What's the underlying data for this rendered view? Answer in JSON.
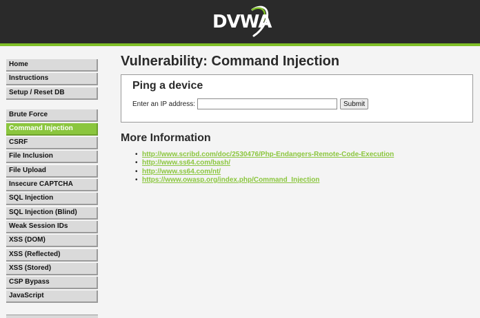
{
  "header": {
    "logo_text": "DVWA",
    "colors": {
      "background": "#2a2a2a",
      "accent": "#7fbf26"
    }
  },
  "sidebar": {
    "groups": [
      {
        "items": [
          {
            "label": "Home"
          },
          {
            "label": "Instructions"
          },
          {
            "label": "Setup / Reset DB"
          }
        ]
      },
      {
        "items": [
          {
            "label": "Brute Force"
          },
          {
            "label": "Command Injection",
            "active": true
          },
          {
            "label": "CSRF"
          },
          {
            "label": "File Inclusion"
          },
          {
            "label": "File Upload"
          },
          {
            "label": "Insecure CAPTCHA"
          },
          {
            "label": "SQL Injection"
          },
          {
            "label": "SQL Injection (Blind)"
          },
          {
            "label": "Weak Session IDs"
          },
          {
            "label": "XSS (DOM)"
          },
          {
            "label": "XSS (Reflected)"
          },
          {
            "label": "XSS (Stored)"
          },
          {
            "label": "CSP Bypass"
          },
          {
            "label": "JavaScript"
          }
        ]
      }
    ],
    "active_color": "#8bc63e"
  },
  "main": {
    "title": "Vulnerability: Command Injection",
    "ping": {
      "title": "Ping a device",
      "ip_label": "Enter an IP address:",
      "ip_value": "",
      "submit_label": "Submit"
    },
    "more_info": {
      "title": "More Information",
      "links": [
        "http://www.scribd.com/doc/2530476/Php-Endangers-Remote-Code-Execution",
        "http://www.ss64.com/bash/",
        "http://www.ss64.com/nt/",
        "https://www.owasp.org/index.php/Command_Injection"
      ]
    }
  }
}
